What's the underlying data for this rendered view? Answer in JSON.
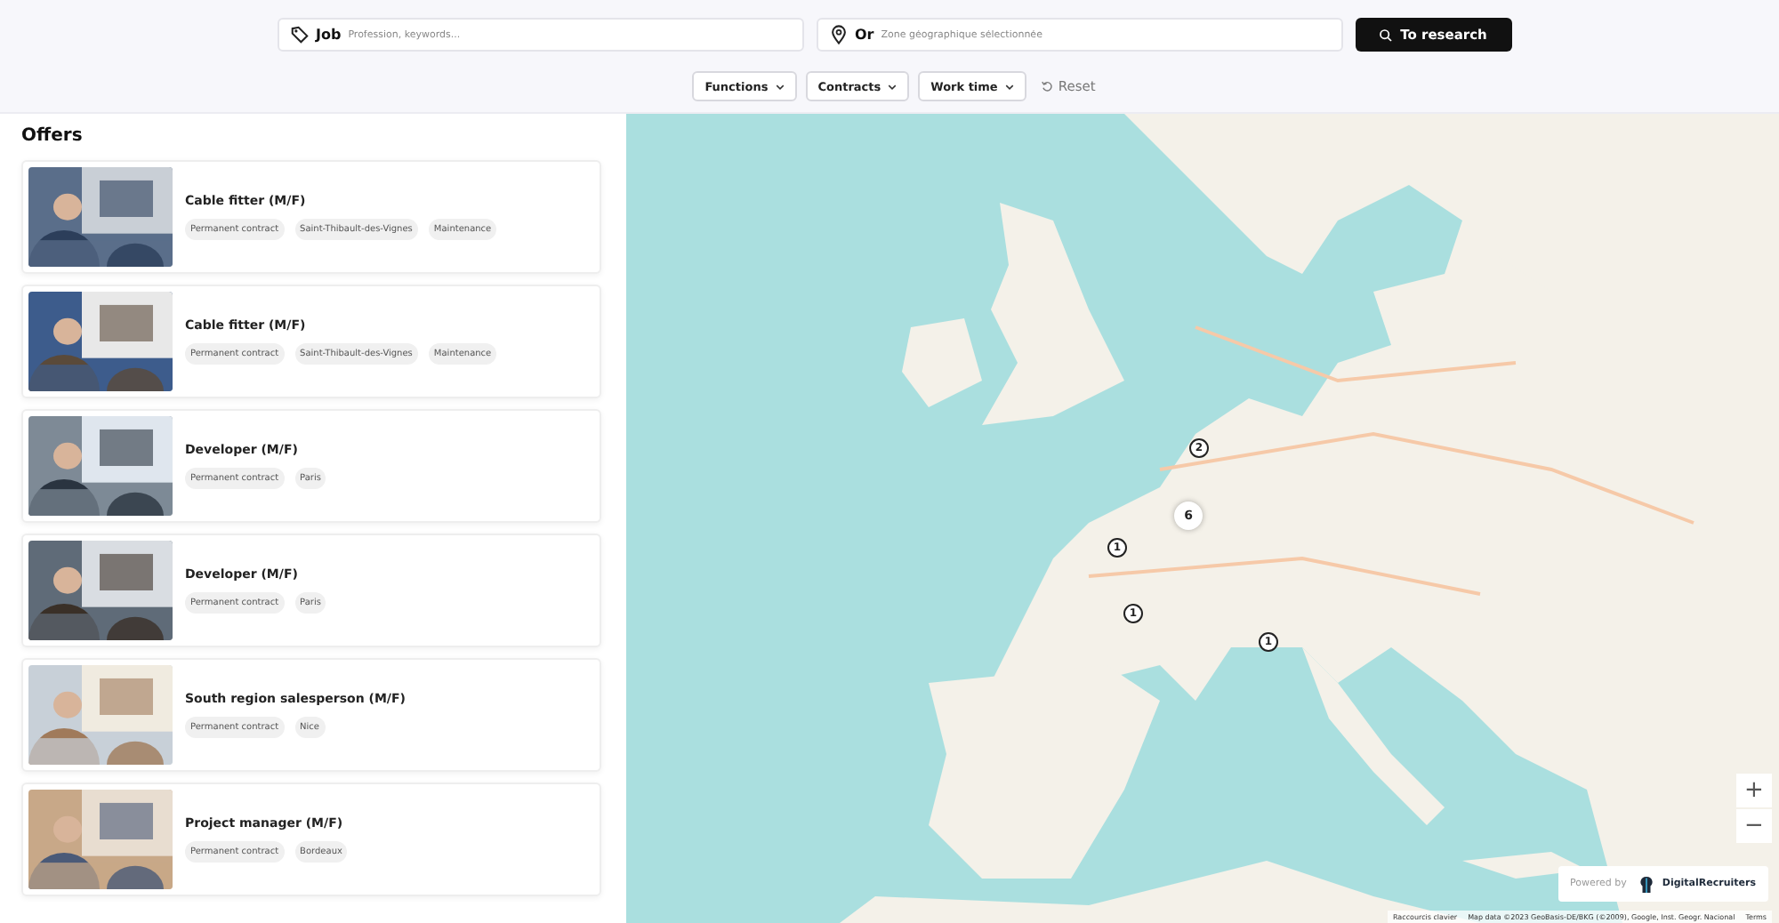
{
  "search": {
    "job": {
      "label": "Job",
      "placeholder": "Profession, keywords..."
    },
    "location": {
      "label": "Or",
      "placeholder": "Zone géographique sélectionnée"
    },
    "button": "To research"
  },
  "filters": [
    {
      "label": "Functions"
    },
    {
      "label": "Contracts"
    },
    {
      "label": "Work time"
    }
  ],
  "reset": "Reset",
  "offers_title": "Offers",
  "offers": [
    {
      "title": "Cable fitter (M/F)",
      "tags": [
        "Permanent contract",
        "Saint-Thibault-des-Vignes",
        "Maintenance"
      ]
    },
    {
      "title": "Cable fitter (M/F)",
      "tags": [
        "Permanent contract",
        "Saint-Thibault-des-Vignes",
        "Maintenance"
      ]
    },
    {
      "title": "Developer (M/F)",
      "tags": [
        "Permanent contract",
        "Paris"
      ]
    },
    {
      "title": "Developer (M/F)",
      "tags": [
        "Permanent contract",
        "Paris"
      ]
    },
    {
      "title": "South region salesperson (M/F)",
      "tags": [
        "Permanent contract",
        "Nice"
      ]
    },
    {
      "title": "Project manager (M/F)",
      "tags": [
        "Permanent contract",
        "Bordeaux"
      ]
    }
  ],
  "map": {
    "markers": [
      {
        "count": "2",
        "kind": "pin"
      },
      {
        "count": "6",
        "kind": "cluster"
      },
      {
        "count": "1",
        "kind": "pin"
      },
      {
        "count": "1",
        "kind": "pin"
      },
      {
        "count": "1",
        "kind": "pin"
      }
    ],
    "zoom_in": "+",
    "zoom_out": "−",
    "powered_by": "Powered by",
    "brand": "DigitalRecruiters",
    "attribution": [
      "Raccourcis clavier",
      "Map data ©2023 GeoBasis-DE/BKG (©2009), Google, Inst. Geogr. Nacional",
      "Terms"
    ]
  }
}
